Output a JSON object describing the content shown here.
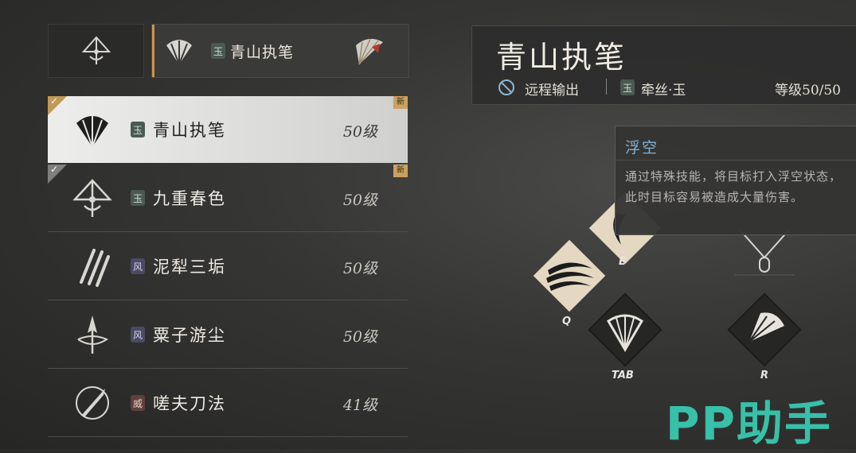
{
  "top_tab": {
    "badge": "玉",
    "name": "青山执笔",
    "left_icon": "umbrella-weapon-icon",
    "fan_icon": "fan-weapon-icon"
  },
  "weapons": [
    {
      "name": "青山执笔",
      "level": "50级",
      "badge": "玉",
      "badge_type": "jade",
      "icon": "fan-weapon-icon",
      "selected": true,
      "new": "新",
      "checked": true
    },
    {
      "name": "九重春色",
      "level": "50级",
      "badge": "玉",
      "badge_type": "jade",
      "icon": "umbrella-weapon-icon",
      "selected": false,
      "new": "新",
      "checked": true
    },
    {
      "name": "泥犁三垢",
      "level": "50级",
      "badge": "风",
      "badge_type": "wind",
      "icon": "claw-weapon-icon",
      "selected": false
    },
    {
      "name": "粟子游尘",
      "level": "50级",
      "badge": "风",
      "badge_type": "wind",
      "icon": "spear-weapon-icon",
      "selected": false
    },
    {
      "name": "嗟夫刀法",
      "level": "41级",
      "badge": "威",
      "badge_type": "mou",
      "icon": "blade-weapon-icon",
      "selected": false
    }
  ],
  "info": {
    "title": "青山执笔",
    "range_label": "远程输出",
    "badge": "玉",
    "silk_label": "牵丝·玉",
    "level_label": "等级50/50"
  },
  "tooltip": {
    "title": "浮空",
    "desc": "通过特殊技能，将目标打入浮空状态，此时目标容易被造成大量伤害。"
  },
  "skills": [
    {
      "key": "E",
      "icon": "crescent-skill-icon"
    },
    {
      "key": "Q",
      "icon": "wind-slash-skill-icon"
    },
    {
      "key": "TAB",
      "icon": "fan-open-skill-icon"
    },
    {
      "key": "R",
      "icon": "fan-strike-skill-icon"
    }
  ],
  "watermark": "PP助手",
  "colors": {
    "accent": "#c9944a",
    "tooltip_title": "#7fb3d6",
    "watermark": "#38c0a8"
  }
}
